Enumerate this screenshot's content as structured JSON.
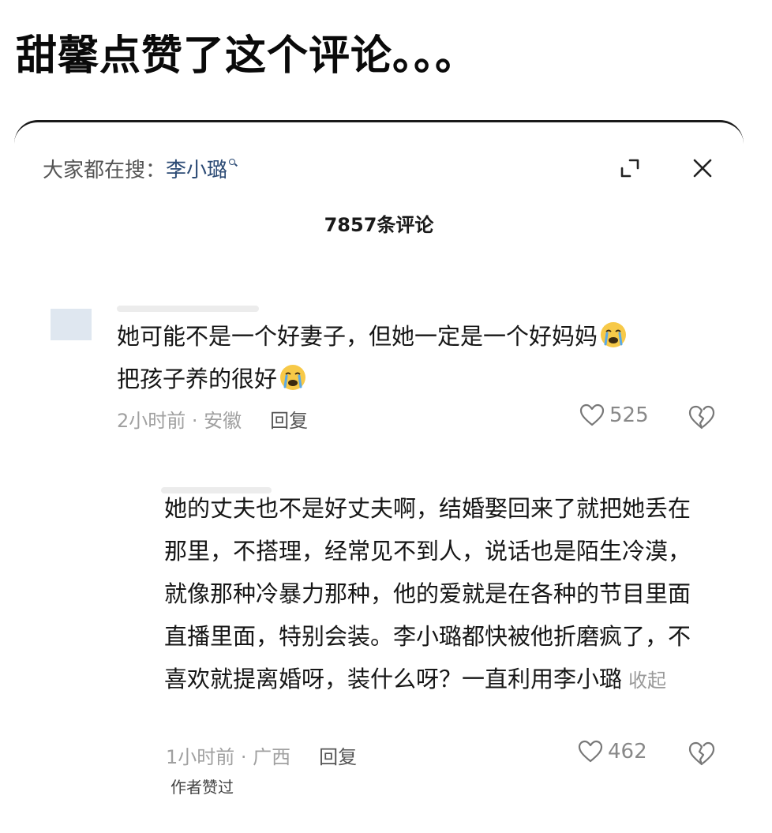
{
  "headline": "甜馨点赞了这个评论。。。",
  "search": {
    "prefix": "大家都在搜：",
    "term": "李小璐"
  },
  "comments_count_title": "7857条评论",
  "comments": [
    {
      "text_line1": "她可能不是一个好妻子，但她一定是一个好妈妈",
      "text_line2": "把孩子养的很好",
      "emoji": "crying-face",
      "time_location": "2小时前 · 安徽",
      "reply_label": "回复",
      "likes": "525"
    },
    {
      "text": "她的丈夫也不是好丈夫啊，结婚娶回来了就把她丢在那里，不搭理，经常见不到人，说话也是陌生冷漠，就像那种冷暴力那种，他的爱就是在各种的节目里面直播里面，特别会装。李小璐都快被他折磨疯了，不喜欢就提离婚呀，装什么呀？一直利用李小璐",
      "collapse_label": "收起",
      "time_location": "1小时前 · 广西",
      "reply_label": "回复",
      "likes": "462",
      "author_badge": "作者赞过"
    }
  ],
  "colors": {
    "search_term": "#2b4a74",
    "meta_gray": "#a0a0a0",
    "emoji_yellow": "#f7c948",
    "tear_blue": "#5aa9e6"
  }
}
